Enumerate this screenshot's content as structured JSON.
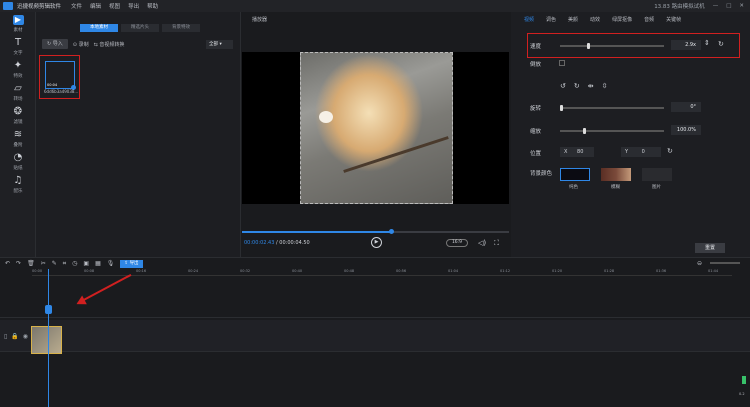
{
  "app": {
    "title": "迅捷视频剪辑软件",
    "menu": [
      "文件",
      "编辑",
      "视图",
      "导出",
      "帮助"
    ],
    "status": "13.83 路由模拟试机"
  },
  "sidebar": [
    {
      "label": "素材",
      "icon": "play-icon"
    },
    {
      "label": "文字",
      "icon": "text-icon"
    },
    {
      "label": "特效",
      "icon": "effects-icon"
    },
    {
      "label": "转场",
      "icon": "transition-icon"
    },
    {
      "label": "滤镜",
      "icon": "filter-icon"
    },
    {
      "label": "叠附",
      "icon": "overlay-icon"
    },
    {
      "label": "贴纸",
      "icon": "sticker-icon"
    },
    {
      "label": "配乐",
      "icon": "music-icon"
    }
  ],
  "library": {
    "tabs": [
      "本地素材",
      "精选片头",
      "背景特效"
    ],
    "import_label": "导入",
    "record_label": "录制",
    "link_label": "音视频转换",
    "filter": "全部",
    "item": {
      "name": "6dd6b3a49038...",
      "duration": "00:04"
    }
  },
  "player": {
    "title": "播放器",
    "current": "00:00:02.43",
    "total": "00:00:04.50",
    "ratio": "16:9",
    "progress": 0.54
  },
  "props": {
    "tabs": [
      "视频",
      "调色",
      "美颜",
      "动效",
      "绿屏抠像",
      "音频",
      "关键帧"
    ],
    "speed_label": "速度",
    "speed_value": "2.9x",
    "speed_level": 0.18,
    "reverse_label": "倒放",
    "rotate_label": "旋转",
    "rotate_value": "0°",
    "rotate_level": 0.0,
    "scale_label": "缩放",
    "scale_value": "100.0%",
    "scale_level": 0.22,
    "position_label": "位置",
    "x_label": "X",
    "x_value": "80",
    "y_label": "Y",
    "y_value": "0",
    "bg_label": "背景颜色",
    "bg_options": [
      {
        "label": "纯色",
        "color": "#0b0b12"
      },
      {
        "label": "模糊",
        "color": "#7a4a3a"
      },
      {
        "label": "图片",
        "color": "#2a2b2f"
      }
    ],
    "reset_label": "重置"
  },
  "timeline": {
    "export_label": "导出",
    "ticks": [
      "00:00",
      "00:08",
      "00:16",
      "00:24",
      "00:32",
      "00:40",
      "00:48",
      "00:56",
      "01:04",
      "01:12",
      "01:20",
      "01:28",
      "01:36",
      "01:44",
      "01:52"
    ],
    "meter": "0.2"
  }
}
